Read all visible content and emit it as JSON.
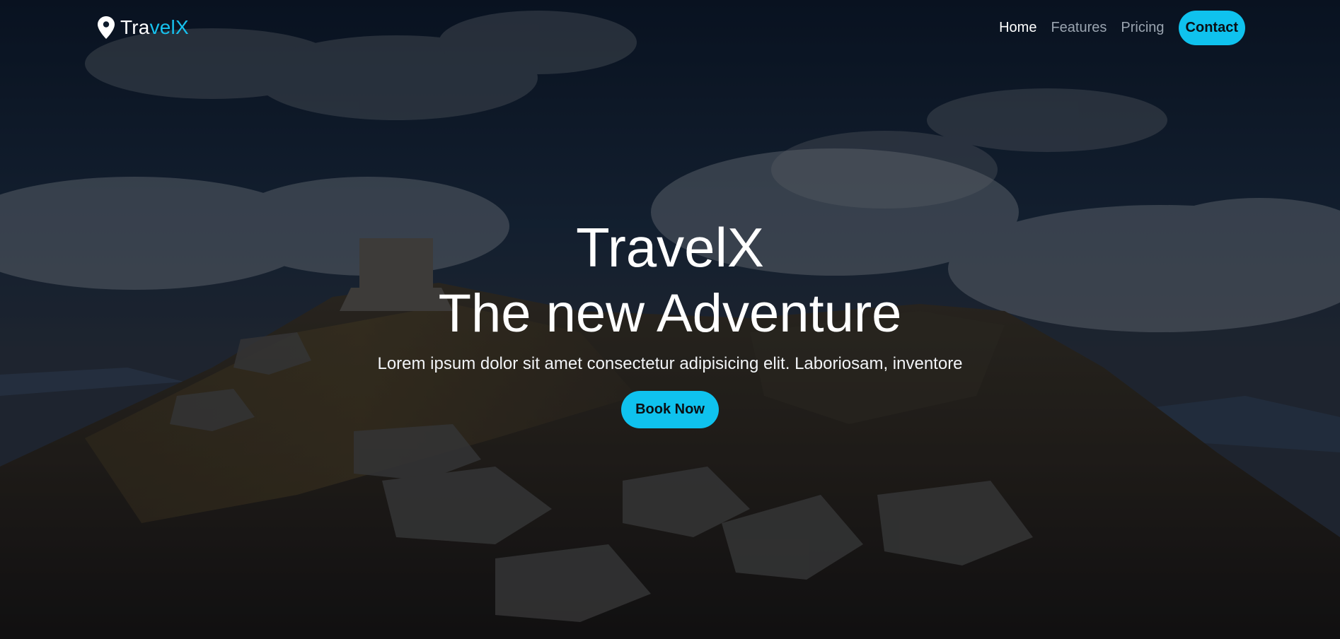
{
  "brand": {
    "text_main": "Tra",
    "text_accent": "velX",
    "icon": "map-pin-icon"
  },
  "nav": {
    "items": [
      {
        "label": "Home",
        "active": true
      },
      {
        "label": "Features",
        "active": false
      },
      {
        "label": "Pricing",
        "active": false
      }
    ],
    "contact_label": "Contact"
  },
  "hero": {
    "title": "TravelX",
    "subtitle": "The new Adventure",
    "lead": "Lorem ipsum dolor sit amet consectetur adipisicing elit. Laboriosam, inventore",
    "cta_label": "Book Now"
  },
  "colors": {
    "accent": "#0fc2ee",
    "brand_accent": "#17c1ee",
    "nav_inactive": "#9aa4b0",
    "text": "#ffffff"
  }
}
